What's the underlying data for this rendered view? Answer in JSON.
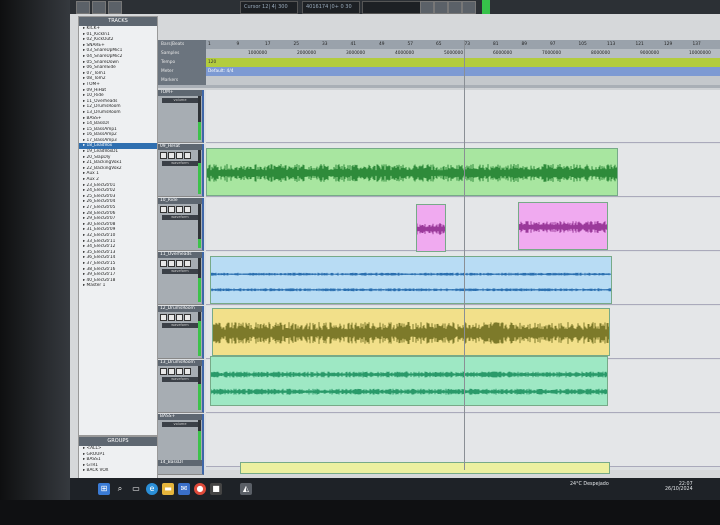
{
  "app": {
    "counter_label": "Cursor",
    "counter_value": "12| 4| 300",
    "counter_value2": "4016174 |0+ 0 30"
  },
  "tracks_panel": {
    "title": "TRACKS",
    "items": [
      "KICK+",
      "01_KickIn1",
      "02_KickOut2",
      "SNARE+",
      "03_SnareUpMic1",
      "04_SnareUpMic2",
      "05_SnareDown",
      "06_SnareSide",
      "07_Tom1",
      "08_Tom2",
      "TOM+",
      "09_HiHat",
      "10_Ride",
      "11_Overheads",
      "12_DrumsRoom",
      "13_DrumsRoom",
      "BASS+",
      "14_BassDI",
      "15_BassAmp1",
      "16_BassAmp2",
      "17_BassAmp3",
      "18_LeadVox",
      "19_LeadVoxD1",
      "20_SlapDly",
      "21_BackingVox1",
      "22_BackingVox2",
      "Aux 1",
      "Aux 2",
      "23_ElecGtr01",
      "24_ElecGtr02",
      "25_ElecGtr03",
      "26_ElecGtr04",
      "27_ElecGtr05",
      "28_ElecGtr06",
      "29_ElecGtr07",
      "30_ElecGtr08",
      "31_ElecGtr09",
      "32_ElecGtr10",
      "33_ElecGtr11",
      "34_ElecGtr12",
      "35_ElecGtr13",
      "36_ElecGtr14",
      "37_ElecGtr15",
      "38_ElecGtr16",
      "39_ElecGtr17",
      "40_ElecGtr18",
      "Master 1"
    ],
    "selected_index": 21
  },
  "groups_panel": {
    "title": "GROUPS",
    "items": [
      "<ALL>",
      "GROUP1",
      "BASS1",
      "GTR1",
      "BACK VOX"
    ]
  },
  "ruler": {
    "rows": [
      "Bars|Beats",
      "Samples",
      "Tempo",
      "Meter",
      "Markers"
    ],
    "bars": [
      "1",
      "9",
      "17",
      "25",
      "33",
      "41",
      "49",
      "57",
      "65",
      "73",
      "81",
      "89",
      "97",
      "105",
      "113",
      "121",
      "129",
      "137"
    ],
    "samples": [
      "1000000",
      "2000000",
      "3000000",
      "4000000",
      "5000000",
      "6000000",
      "7000000",
      "8000000",
      "9000000",
      "10000000"
    ],
    "tempo_value": "120",
    "meter_value": "Default: 4/4"
  },
  "tracks": [
    {
      "name": "TOM+",
      "mode": "volume",
      "type": "folder"
    },
    {
      "name": "09_HiHat",
      "mode": "waveform",
      "color": "#a8e6a0",
      "wave": "#2e8b3a"
    },
    {
      "name": "10_Ride",
      "mode": "waveform",
      "color": "#f0aaf0",
      "wave": "#9b3a9b"
    },
    {
      "name": "11_Overheads",
      "mode": "waveform",
      "color": "#b8dcf4",
      "wave": "#2a6fb0"
    },
    {
      "name": "12_DrumsRoom",
      "mode": "waveform",
      "color": "#f2e08a",
      "wave": "#7d7a2a"
    },
    {
      "name": "13_DrumsRoom",
      "mode": "waveform",
      "color": "#9ee8c4",
      "wave": "#2a9a6a"
    },
    {
      "name": "BASS+",
      "mode": "volume",
      "type": "folder"
    },
    {
      "name": "14_BassDI",
      "mode": "waveform",
      "color": "#ecf0a0",
      "wave": "#8a8a2a"
    }
  ],
  "colors": {
    "accent": "#3f67a8",
    "tempo": "#b3cc3d",
    "meter": "#7d9ad3"
  },
  "taskbar": {
    "icons": [
      "windows-start",
      "search",
      "task-view",
      "edge",
      "folder",
      "mail",
      "chrome",
      "app",
      "pro-tools"
    ],
    "weather": "24°C Despejado",
    "time": "22:07",
    "date": "26/10/2024"
  }
}
